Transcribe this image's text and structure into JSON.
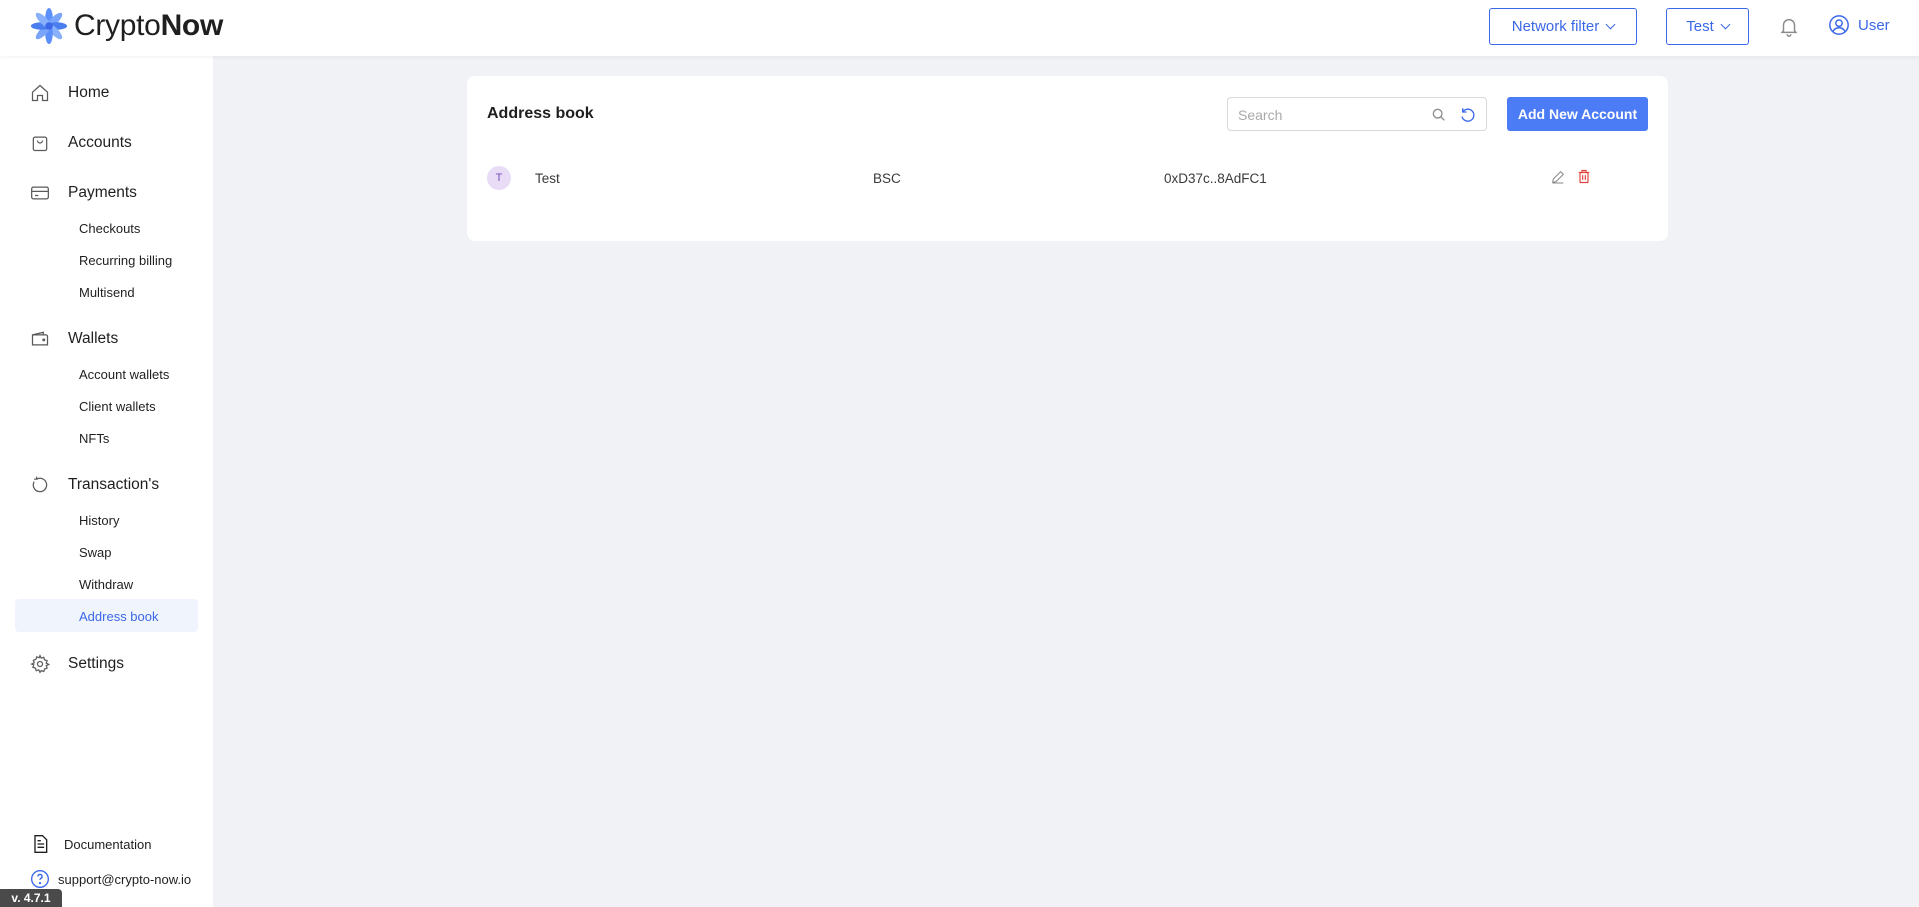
{
  "header": {
    "logo_regular": "Crypto",
    "logo_bold": "Now",
    "network_filter_label": "Network filter",
    "account_select_label": "Test",
    "user_label": "User"
  },
  "sidebar": {
    "home": "Home",
    "accounts": "Accounts",
    "payments": "Payments",
    "checkouts": "Checkouts",
    "recurring_billing": "Recurring billing",
    "multisend": "Multisend",
    "wallets": "Wallets",
    "account_wallets": "Account wallets",
    "client_wallets": "Client wallets",
    "nfts": "NFTs",
    "transactions": "Transaction's",
    "history": "History",
    "swap": "Swap",
    "withdraw": "Withdraw",
    "address_book": "Address book",
    "settings": "Settings",
    "documentation": "Documentation",
    "support_email": "support@crypto-now.io",
    "version": "v. 4.7.1"
  },
  "main": {
    "title": "Address book",
    "search_placeholder": "Search",
    "add_button": "Add New Account",
    "rows": [
      {
        "initial": "T",
        "name": "Test",
        "network": "BSC",
        "address": "0xD37c..8AdFC1"
      }
    ]
  },
  "colors": {
    "accent": "#3b68e8",
    "primary_button": "#4b7bf5",
    "delete": "#e0463c",
    "active_nav_bg": "#f0f4fd",
    "page_bg": "#f0f2f5"
  }
}
